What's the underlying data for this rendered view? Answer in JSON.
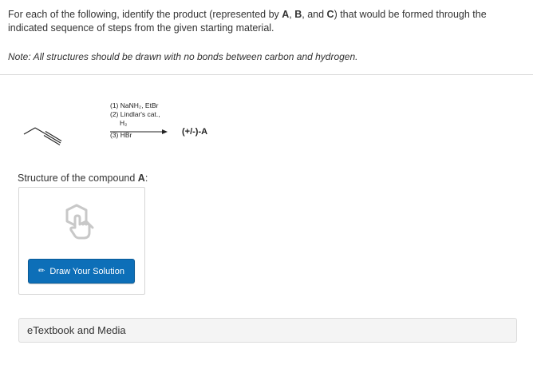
{
  "question": {
    "part1": "For each of the following, identify the product (represented by ",
    "A": "A",
    "comma1": ", ",
    "B": "B",
    "and": ", and ",
    "C": "C",
    "part2": ") that would be formed through the indicated sequence of steps from the given starting material.",
    "note": "Note: All structures should be drawn with no bonds between carbon and hydrogen."
  },
  "scheme": {
    "step1": "(1) NaNH₂, EtBr",
    "step2": "(2) Lindlar's cat.,",
    "h2": "H₂",
    "step3": "(3) HBr",
    "product": "(+/-)-A"
  },
  "structure": {
    "label": "Structure of the compound ",
    "label_bold": "A",
    "colon": ":"
  },
  "draw_button": {
    "label": "Draw Your Solution"
  },
  "etextbook": {
    "label": "eTextbook and Media"
  },
  "colors": {
    "button": "#0d6fb8",
    "divider": "#d9d9d9",
    "panel": "#f4f4f4"
  }
}
